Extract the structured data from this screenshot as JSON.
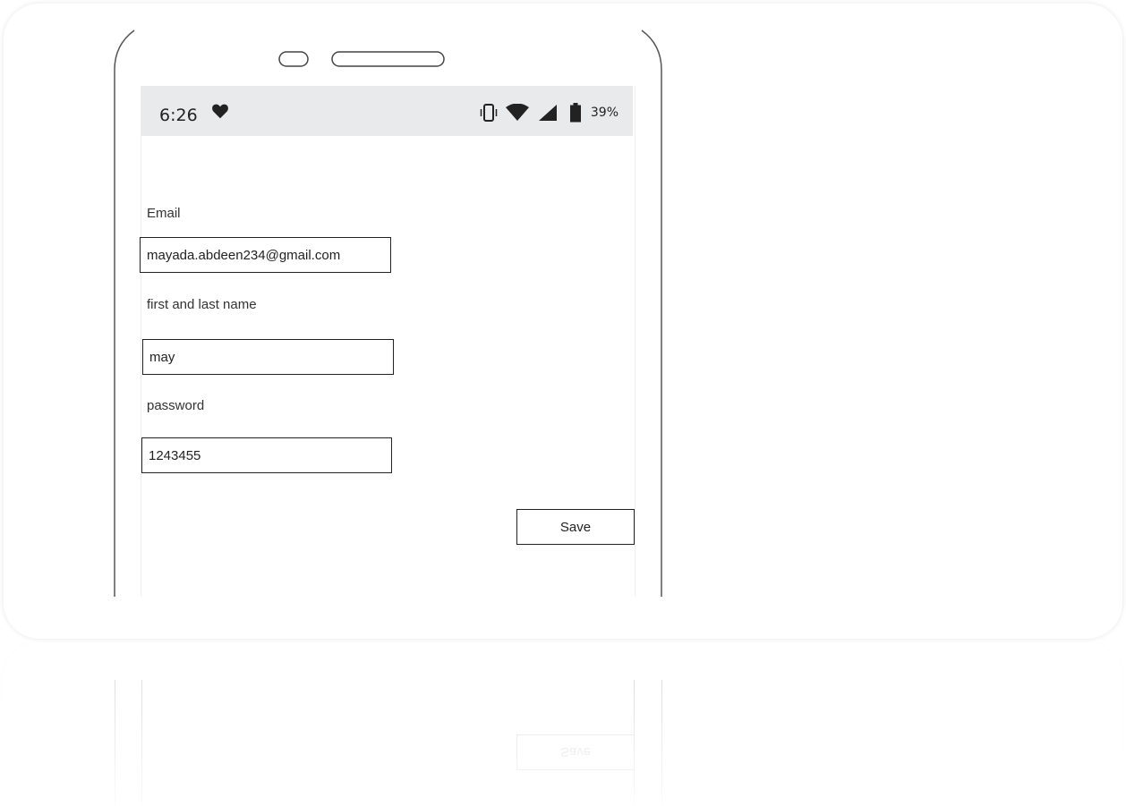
{
  "status_bar": {
    "time": "6:26",
    "battery_percent": "39%",
    "icons": [
      "heart-icon",
      "vibrate-icon",
      "wifi-icon",
      "cell-signal-icon",
      "battery-icon"
    ]
  },
  "form": {
    "email_label": "Email",
    "email_value": "mayada.abdeen234@gmail.com",
    "name_label": "first and last name",
    "name_value": "may",
    "password_label": "password",
    "password_value": "1243455",
    "save_label": "Save"
  },
  "colors": {
    "status_bar_bg": "#e8eaec",
    "frame_stroke": "#555555",
    "border": "#222222"
  }
}
